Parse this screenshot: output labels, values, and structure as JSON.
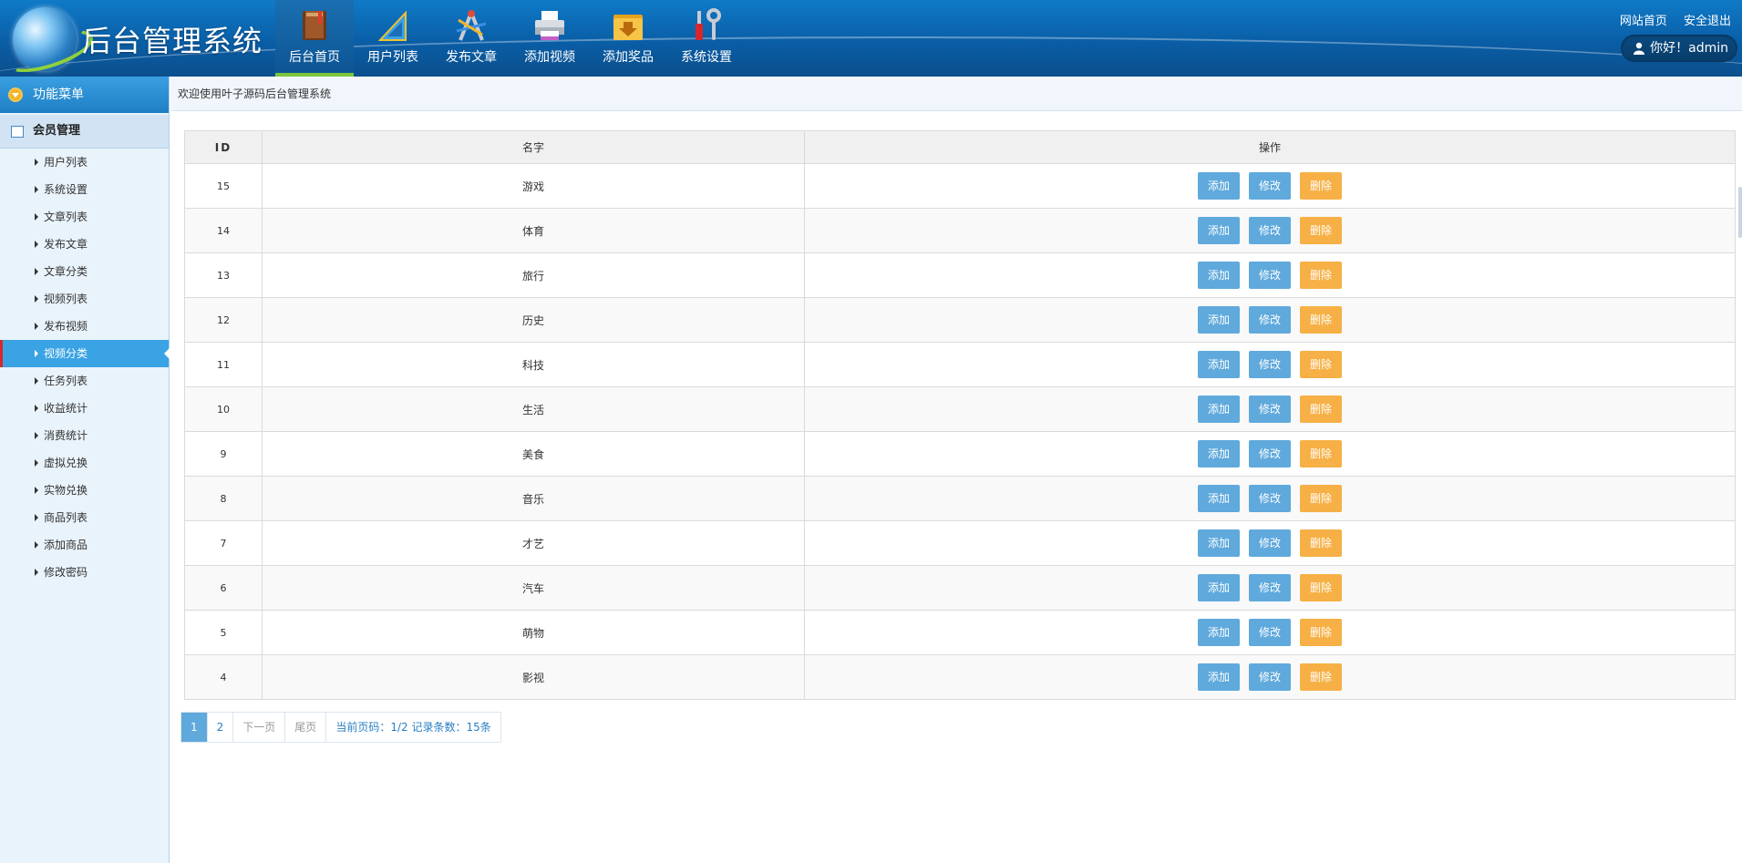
{
  "app": {
    "title": "后台管理系统"
  },
  "top_nav": [
    {
      "label": "后台首页",
      "icon": "book-icon",
      "active": true
    },
    {
      "label": "用户列表",
      "icon": "ruler-icon",
      "active": false
    },
    {
      "label": "发布文章",
      "icon": "compass-icon",
      "active": false
    },
    {
      "label": "添加视频",
      "icon": "printer-icon",
      "active": false
    },
    {
      "label": "添加奖品",
      "icon": "download-folder-icon",
      "active": false
    },
    {
      "label": "系统设置",
      "icon": "tools-icon",
      "active": false
    }
  ],
  "top_links": {
    "home": "网站首页",
    "logout": "安全退出"
  },
  "user": {
    "greeting": "你好！admin"
  },
  "sidebar": {
    "header": "功能菜单",
    "group": "会员管理",
    "items": [
      {
        "label": "用户列表"
      },
      {
        "label": "系统设置"
      },
      {
        "label": "文章列表"
      },
      {
        "label": "发布文章"
      },
      {
        "label": "文章分类"
      },
      {
        "label": "视频列表"
      },
      {
        "label": "发布视频"
      },
      {
        "label": "视频分类",
        "active": true
      },
      {
        "label": "任务列表"
      },
      {
        "label": "收益统计"
      },
      {
        "label": "消费统计"
      },
      {
        "label": "虚拟兑换"
      },
      {
        "label": "实物兑换"
      },
      {
        "label": "商品列表"
      },
      {
        "label": "添加商品"
      },
      {
        "label": "修改密码"
      }
    ]
  },
  "breadcrumb": "欢迎使用叶子源码后台管理系统",
  "table": {
    "columns": [
      "ID",
      "名字",
      "操作"
    ],
    "actions": {
      "add": "添加",
      "edit": "修改",
      "delete": "删除"
    },
    "rows": [
      {
        "id": "15",
        "name": "游戏"
      },
      {
        "id": "14",
        "name": "体育"
      },
      {
        "id": "13",
        "name": "旅行"
      },
      {
        "id": "12",
        "name": "历史"
      },
      {
        "id": "11",
        "name": "科技"
      },
      {
        "id": "10",
        "name": "生活"
      },
      {
        "id": "9",
        "name": "美食"
      },
      {
        "id": "8",
        "name": "音乐"
      },
      {
        "id": "7",
        "name": "才艺"
      },
      {
        "id": "6",
        "name": "汽车"
      },
      {
        "id": "5",
        "name": "萌物"
      },
      {
        "id": "4",
        "name": "影视"
      }
    ]
  },
  "pagination": {
    "pages": [
      "1",
      "2"
    ],
    "current": "1",
    "next": "下一页",
    "last": "尾页",
    "info": "当前页码：1/2 记录条数：15条"
  },
  "colors": {
    "header_blue": "#0a5ea6",
    "active_menu": "#3aa3e3",
    "button_blue": "#5fa9dc",
    "button_orange": "#f6b045",
    "active_underline": "#7bc63c"
  }
}
